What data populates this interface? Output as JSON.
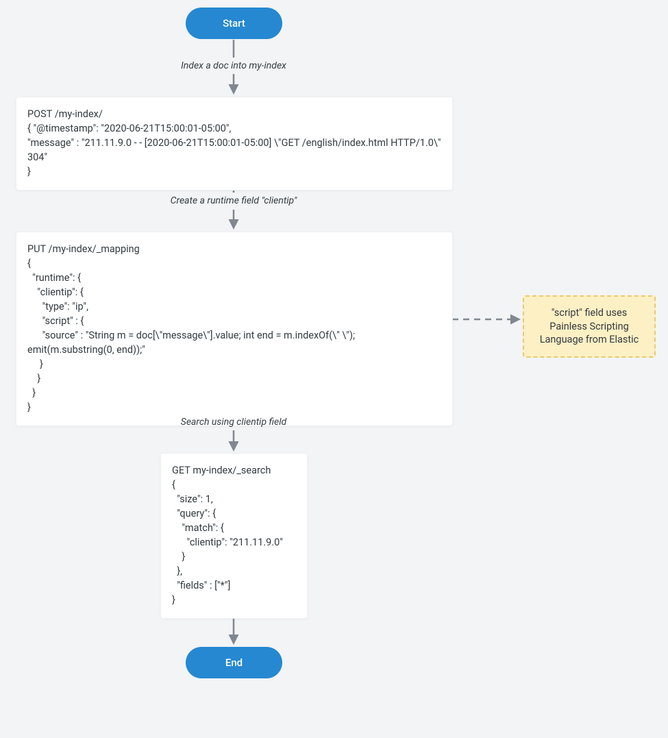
{
  "start": {
    "label": "Start"
  },
  "end": {
    "label": "End"
  },
  "labels": {
    "index": "Index a doc into my-index",
    "create": "Create a runtime field \"clientip\"",
    "search": "Search using clientip field"
  },
  "box1": "POST /my-index/\n{ \"@timestamp\": \"2020-06-21T15:00:01-05:00\",\n\"message\" : \"211.11.9.0 - - [2020-06-21T15:00:01-05:00] \\\"GET /english/index.html HTTP/1.0\\\" 304\"\n}",
  "box2": "PUT /my-index/_mapping\n{\n  \"runtime\": {\n    \"clientip\": {\n      \"type\": \"ip\",\n      \"script\" : {\n      \"source\" : \"String m = doc[\\\"message\\\"].value; int end = m.indexOf(\\\" \\\"); emit(m.substring(0, end));\"\n     }\n    }\n  }\n}",
  "box3": "GET my-index/_search\n{\n  \"size\": 1,\n  \"query\": {\n    \"match\": {\n      \"clientip\": \"211.11.9.0\"\n    }\n  },\n  \"fields\" : [\"*\"]\n}",
  "note": "\"script\" field uses Painless Scripting Language from Elastic"
}
